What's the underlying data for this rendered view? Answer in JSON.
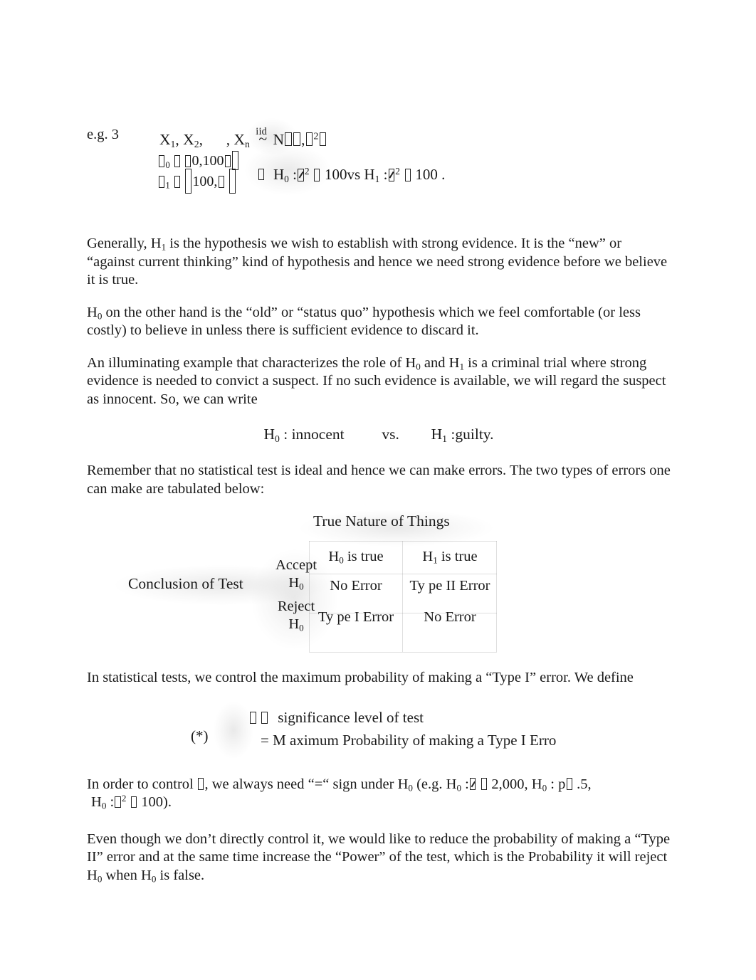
{
  "document": {
    "type": "lecture-notes",
    "topic": "Hypothesis Testing — Type I and Type II Errors"
  },
  "example": {
    "label": "e.g. 3",
    "iid_label": "iid",
    "tilde": "~",
    "dist_name": "N",
    "comma": ",",
    "sup_two": "2",
    "case0_sub": "0",
    "case0_interval": "0,100",
    "case1_sub": "1",
    "case1_interval": "100,",
    "hyp_h": "H",
    "h0_sub": "0",
    "h1_sub": "1",
    "colon": ":",
    "value_100": "100",
    "vs": "vs",
    "period": ".",
    "sigma_sup": "2"
  },
  "paragraphs": {
    "generally": {
      "lead": "Generally,",
      "h": "H",
      "sub": "1",
      "rest": "is the hypothesis we wish to establish with strong evidence.  It is the “new” or “against current thinking” kind of hypothesis and hence we need strong evidence before we believe it is true."
    },
    "h0_statusquo": {
      "h": "H",
      "sub": "0",
      "rest": "on the other hand is the “old” or “status quo” hypothesis which we feel comfortable (or less costly) to believe in unless there is sufficient evidence to discard it."
    },
    "criminal_trial": {
      "lead": "An illuminating example that characterizes the role of",
      "h_a": "H",
      "sub_a": "0",
      "mid": "and",
      "h_b": "H",
      "sub_b": "1",
      "rest": "is a criminal trial where strong evidence is needed to convict a suspect.  If no such evidence is available, we will regard the suspect as innocent.  So, we can write"
    },
    "remember": "Remember that no statistical test is ideal and hence we can make errors.  The two types of errors one can make are tabulated below:",
    "control_max": "In statistical tests, we control the maximum probability of making a “Type I” error.  We define",
    "order_to_control": {
      "lead": "In order to control",
      "mid1": ", we always need “=“ sign under",
      "h": "H",
      "sub": "0",
      "eg": "(e.g.",
      "h_mu": "H",
      "sub_mu": "0",
      "colon": ":",
      "val_mu": "2,000",
      "comma": ",",
      "h_p": "H",
      "sub_p": "0",
      "p_letter": "p",
      "val_p": ".5,",
      "h_sig": "H",
      "sub_sig": "0",
      "sig_sup": "2",
      "val_sig": "100",
      "close": ")."
    },
    "type_two": {
      "lead": "Even though we don’t directly control it, we would like to reduce the probability of making a “Type II” error  and at the same time increase the “Power” of the test, which is the Probability it will reject",
      "h_a": "H",
      "sub_a": "0",
      "mid": "when",
      "h_b": "H",
      "sub_b": "0",
      "rest": "is false."
    }
  },
  "hypothesis_line": {
    "h0": "H",
    "h0_sub": "0",
    "colon": ":",
    "h0_text": "innocent",
    "vs": "vs.",
    "h1": "H",
    "h1_sub": "1",
    "h1_text": "guilty",
    "period": "."
  },
  "error_table": {
    "title": "True Nature of Things",
    "row_header_label": "Conclusion of Test",
    "row_labels": [
      {
        "verb": "Accept",
        "h": "H",
        "sub": "0"
      },
      {
        "verb": "Reject",
        "h": "H",
        "sub": "0"
      }
    ],
    "column_headers": [
      {
        "h": "H",
        "sub": "0",
        "text": "is  true"
      },
      {
        "h": "H",
        "sub": "1",
        "text": "is  true"
      }
    ],
    "cells": [
      [
        "No Error",
        "Ty pe II Error"
      ],
      [
        "Ty pe I Error",
        "No Error"
      ]
    ]
  },
  "star_definition": {
    "marker": "(*)",
    "line1": "significance level of test",
    "line2": "= M aximum Probability of making a Type I Erro"
  },
  "colors": {
    "text": "#1a1a1a",
    "page_background": "#ffffff",
    "table_rule": "rgba(150,150,150,0.30)",
    "halo": "rgba(120,120,120,0.16)"
  }
}
